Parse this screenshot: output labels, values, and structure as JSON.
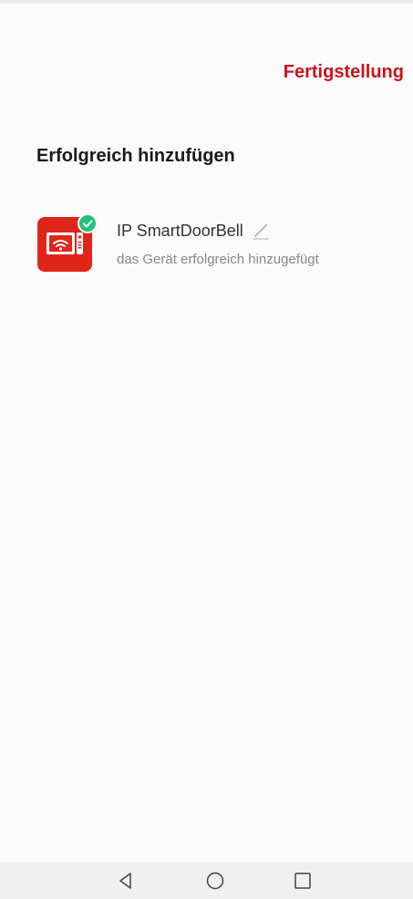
{
  "header": {
    "done_label": "Fertigstellung"
  },
  "page": {
    "title": "Erfolgreich hinzufügen"
  },
  "device": {
    "name": "IP SmartDoorBell",
    "status": "das Gerät erfolgreich hinzugefügt",
    "icon": "smart-doorbell-icon",
    "badge_icon": "check-icon"
  },
  "navigation": {
    "back_icon": "back-icon",
    "home_icon": "home-icon",
    "recents_icon": "recents-icon"
  },
  "colors": {
    "accent": "#c8141e",
    "device_icon_bg": "#e0251b",
    "success": "#21c27a"
  }
}
